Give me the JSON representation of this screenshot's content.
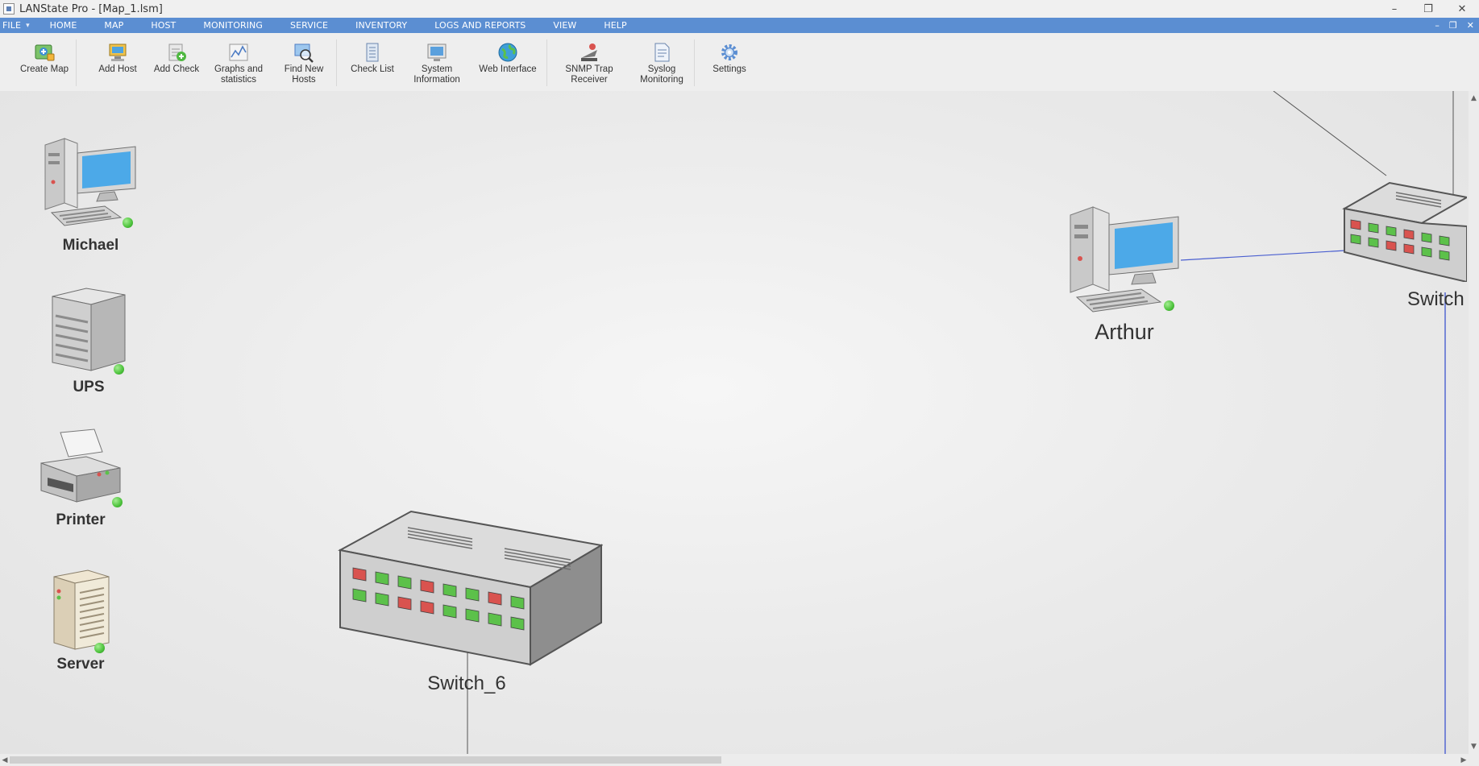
{
  "window": {
    "title": "LANState Pro - [Map_1.lsm]",
    "controls": {
      "minimize": "–",
      "restore": "❐",
      "close": "✕"
    },
    "mdi_controls": {
      "minimize": "–",
      "restore": "❐",
      "close": "✕"
    }
  },
  "menu": {
    "items": [
      "FILE",
      "HOME",
      "MAP",
      "HOST",
      "MONITORING",
      "SERVICE",
      "INVENTORY",
      "LOGS AND REPORTS",
      "VIEW",
      "HELP"
    ],
    "file_arrow": "▾"
  },
  "ribbon": {
    "buttons": [
      {
        "label": "Create Map",
        "icon": "create-map-icon"
      },
      {
        "label": "Add Host",
        "icon": "add-host-icon"
      },
      {
        "label": "Add Check",
        "icon": "add-check-icon"
      },
      {
        "label": "Graphs and\nstatistics",
        "icon": "graphs-icon"
      },
      {
        "label": "Find New\nHosts",
        "icon": "find-hosts-icon"
      },
      {
        "label": "Check List",
        "icon": "check-list-icon"
      },
      {
        "label": "System\nInformation",
        "icon": "system-info-icon"
      },
      {
        "label": "Web Interface",
        "icon": "globe-icon"
      },
      {
        "label": "SNMP Trap\nReceiver",
        "icon": "snmp-trap-icon"
      },
      {
        "label": "Syslog\nMonitoring",
        "icon": "syslog-icon"
      },
      {
        "label": "Settings",
        "icon": "gear-icon"
      }
    ]
  },
  "map": {
    "hosts": [
      {
        "name": "Michael",
        "type": "workstation",
        "status": "online"
      },
      {
        "name": "UPS",
        "type": "ups",
        "status": "online"
      },
      {
        "name": "Printer",
        "type": "printer",
        "status": "online"
      },
      {
        "name": "Server",
        "type": "server",
        "status": "online"
      },
      {
        "name": "Switch_6",
        "type": "switch"
      },
      {
        "name": "Arthur",
        "type": "workstation",
        "status": "online"
      },
      {
        "name": "Switch",
        "type": "switch"
      }
    ]
  },
  "colors": {
    "menubar": "#5b8ed2",
    "status_online": "#4cc23b",
    "link_line": "#4a5fd0",
    "link_gray": "#555555"
  },
  "scroll": {
    "up": "▲",
    "down": "▼",
    "left": "◀",
    "right": "▶"
  }
}
